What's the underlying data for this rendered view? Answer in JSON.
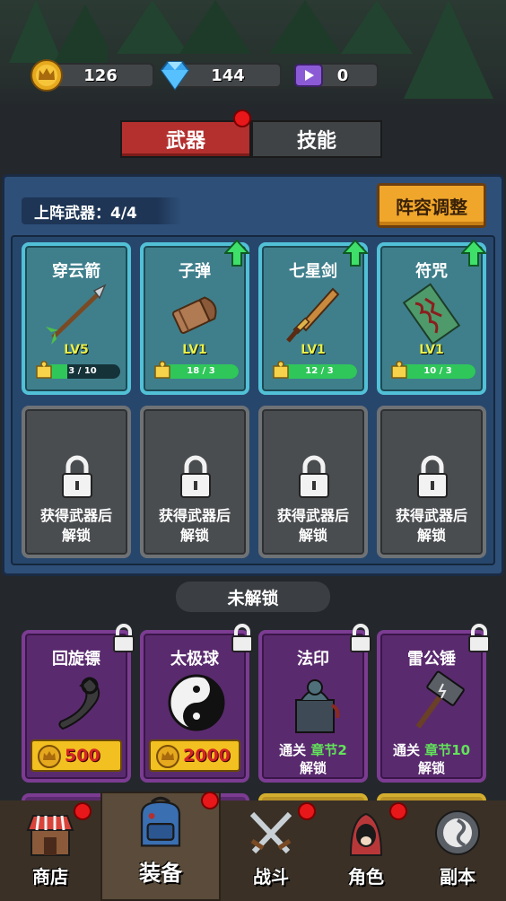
{
  "currency": {
    "crown": "126",
    "gem": "144",
    "ticket": "0"
  },
  "tabs": [
    {
      "label": "武器"
    },
    {
      "label": "技能"
    }
  ],
  "lineup": {
    "text": "上阵武器：4/4",
    "adjust_button": "阵容调整"
  },
  "equipped": [
    {
      "name": "穿云箭",
      "level": "LV5",
      "progress_text": "3 / 10",
      "progress": 0.3
    },
    {
      "name": "子弹",
      "level": "LV1",
      "progress_text": "18 / 3",
      "progress": 1.0
    },
    {
      "name": "七星剑",
      "level": "LV1",
      "progress_text": "12 / 3",
      "progress": 1.0
    },
    {
      "name": "符咒",
      "level": "LV1",
      "progress_text": "10 / 3",
      "progress": 1.0
    }
  ],
  "locked_slots": [
    {
      "line1": "获得武器后",
      "line2": "解锁"
    },
    {
      "line1": "获得武器后",
      "line2": "解锁"
    },
    {
      "line1": "获得武器后",
      "line2": "解锁"
    },
    {
      "line1": "获得武器后",
      "line2": "解锁"
    }
  ],
  "unlock_section": {
    "label": "未解锁"
  },
  "unlockables": [
    {
      "name": "回旋镖",
      "price": "500"
    },
    {
      "name": "太极球",
      "price": "2000"
    },
    {
      "name": "法印",
      "cond_prefix": "通关",
      "cond_chapter": "章节2",
      "cond_suffix": "解锁"
    },
    {
      "name": "雷公锤",
      "cond_prefix": "通关",
      "cond_chapter": "章节10",
      "cond_suffix": "解锁"
    }
  ],
  "nav": [
    {
      "label": "商店",
      "icon": "shop-icon"
    },
    {
      "label": "装备",
      "icon": "backpack-icon"
    },
    {
      "label": "战斗",
      "icon": "crossed-swords-icon"
    },
    {
      "label": "角色",
      "icon": "hooded-character-icon"
    },
    {
      "label": "副本",
      "icon": "portal-icon"
    }
  ],
  "colors": {
    "accent_red": "#b3302e",
    "panel_blue": "#2e4f78",
    "button_orange": "#f0a62b",
    "progress_green": "#2fc75a",
    "locked_purple": "#5a2a6e"
  }
}
